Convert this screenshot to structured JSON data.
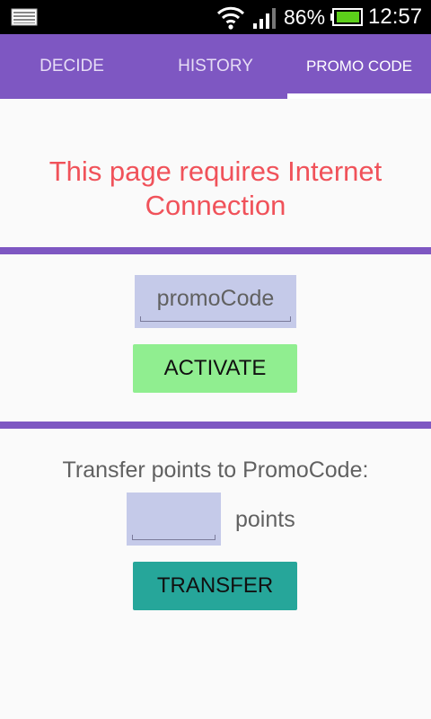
{
  "status_bar": {
    "battery_percent": "86%",
    "time": "12:57",
    "icons": [
      "notification-icon",
      "wifi-icon",
      "signal-icon",
      "battery-icon"
    ]
  },
  "tabs": [
    {
      "label": "DECIDE",
      "active": false
    },
    {
      "label": "HISTORY",
      "active": false
    },
    {
      "label": "PROMO CODE",
      "active": true
    }
  ],
  "warning_text": "This page requires Internet Connection",
  "promo": {
    "placeholder": "promoCode",
    "value": "",
    "activate_label": "ACTIVATE"
  },
  "transfer": {
    "prompt": "Transfer points to PromoCode:",
    "points_value": "",
    "points_suffix": "points",
    "button_label": "TRANSFER"
  },
  "colors": {
    "accent": "#7e57c2",
    "warning": "#f0525a",
    "input_bg": "#c5cae9",
    "activate_bg": "#90ee90",
    "transfer_bg": "#26a69a"
  }
}
